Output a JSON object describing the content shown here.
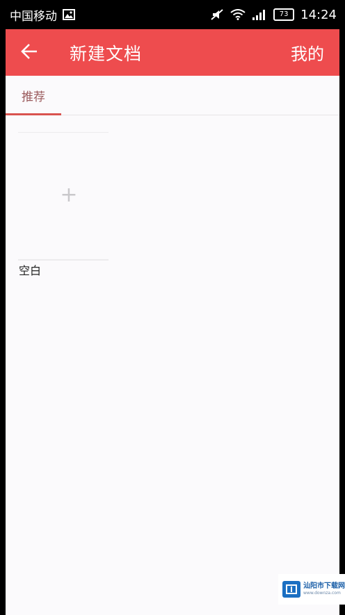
{
  "status_bar": {
    "carrier": "中国移动",
    "battery": "73",
    "time": "14:24",
    "icons": [
      "image-notification-icon",
      "mute-icon",
      "wifi-icon",
      "signal-icon",
      "battery-icon"
    ]
  },
  "toolbar": {
    "title": "新建文档",
    "right_action": "我的",
    "back_icon": "arrow-left-icon",
    "background_color": "#ee4c4e"
  },
  "tabs": [
    {
      "label": "推荐",
      "selected": true
    }
  ],
  "templates": [
    {
      "label": "空白",
      "icon": "plus-icon"
    }
  ],
  "colors": {
    "accent": "#ee4c4e",
    "tab_indicator": "#d9534f",
    "background": "#fbfafc"
  },
  "watermark": {
    "title": "汕阳市下载网",
    "subtitle": "www.downza.com"
  }
}
